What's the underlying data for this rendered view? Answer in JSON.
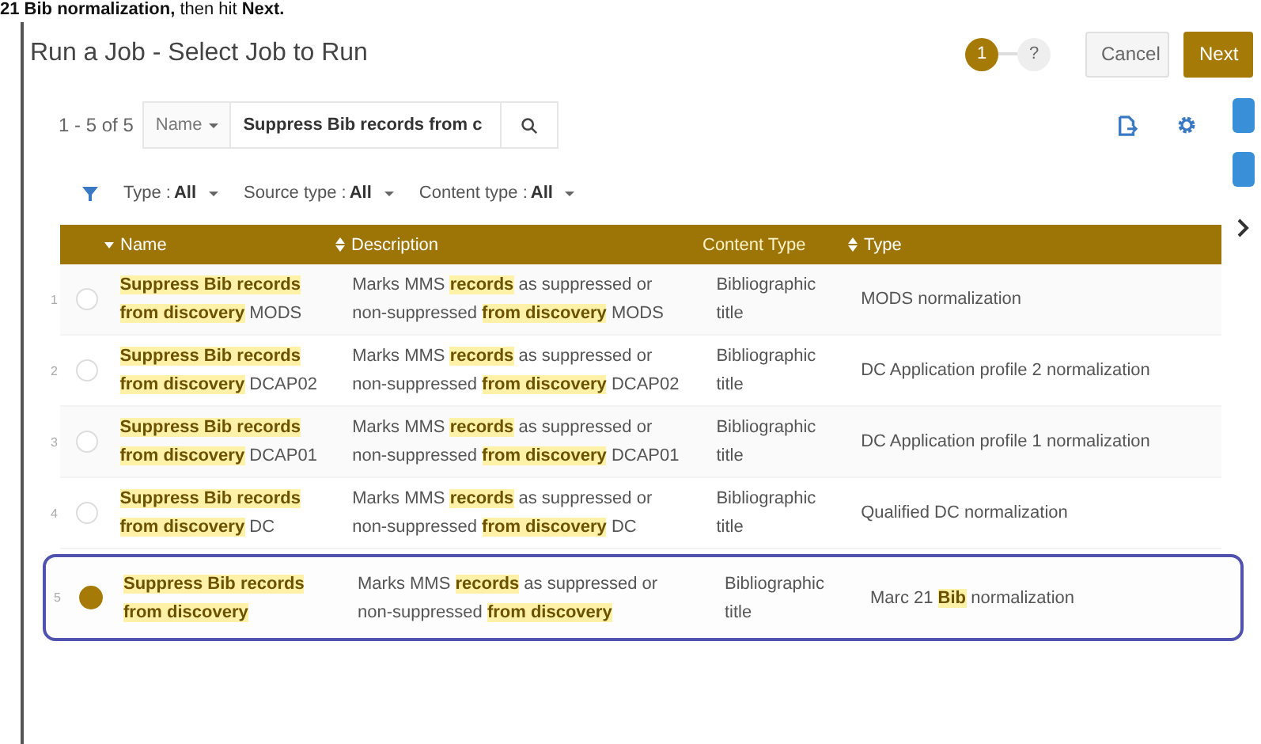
{
  "instruction": "**21 Bib normalization,** then hit **Next.**",
  "window": {
    "title": "Run a Job - Select Job to Run"
  },
  "stepper": [
    {
      "label": "1",
      "selected": true
    },
    {
      "label": "?",
      "selected": false
    }
  ],
  "buttons": [
    {
      "label": "Cancel",
      "kind": "secondary"
    },
    {
      "label": "Next",
      "kind": "primary"
    }
  ],
  "toolbar": {
    "count": "1 - 5 of 5",
    "search_scope": "Name",
    "search_value": "Suppress Bib records from c"
  },
  "filters": [
    {
      "label": "Type : ",
      "value": "All"
    },
    {
      "label": "Source type : ",
      "value": "All"
    },
    {
      "label": "Content type : ",
      "value": "All"
    }
  ],
  "table": {
    "columns": [
      {
        "label": "Name",
        "kind": "sorted"
      },
      {
        "label": "Description",
        "kind": "sortable"
      },
      {
        "label": "Content Type",
        "kind": "plain"
      },
      {
        "label": "Type",
        "kind": "sortable"
      }
    ],
    "rows": [
      {
        "number": "1",
        "selected": false,
        "name": "**Suppress Bib records from discovery** MODS",
        "description": "Marks MMS **records** as suppressed or non-suppressed **from discovery** MODS",
        "content_type": "Bibliographic title",
        "type": "MODS normalization"
      },
      {
        "number": "2",
        "selected": false,
        "name": "**Suppress Bib records from discovery** DCAP02",
        "description": "Marks MMS **records** as suppressed or non-suppressed **from discovery** DCAP02",
        "content_type": "Bibliographic title",
        "type": "DC Application profile 2 normalization"
      },
      {
        "number": "3",
        "selected": false,
        "name": "**Suppress Bib records from discovery** DCAP01",
        "description": "Marks MMS **records** as suppressed or non-suppressed **from discovery** DCAP01",
        "content_type": "Bibliographic title",
        "type": "DC Application profile 1 normalization"
      },
      {
        "number": "4",
        "selected": false,
        "name": "**Suppress Bib records from discovery** DC",
        "description": "Marks MMS **records** as suppressed or non-suppressed **from discovery** DC",
        "content_type": "Bibliographic title",
        "type": "Qualified DC normalization"
      },
      {
        "number": "5",
        "selected": true,
        "name": "**Suppress Bib records from discovery**",
        "description": "Marks MMS **records** as suppressed or non-suppressed **from discovery**",
        "content_type": "Bibliographic title",
        "type": "Marc 21 **Bib** normalization"
      }
    ]
  }
}
